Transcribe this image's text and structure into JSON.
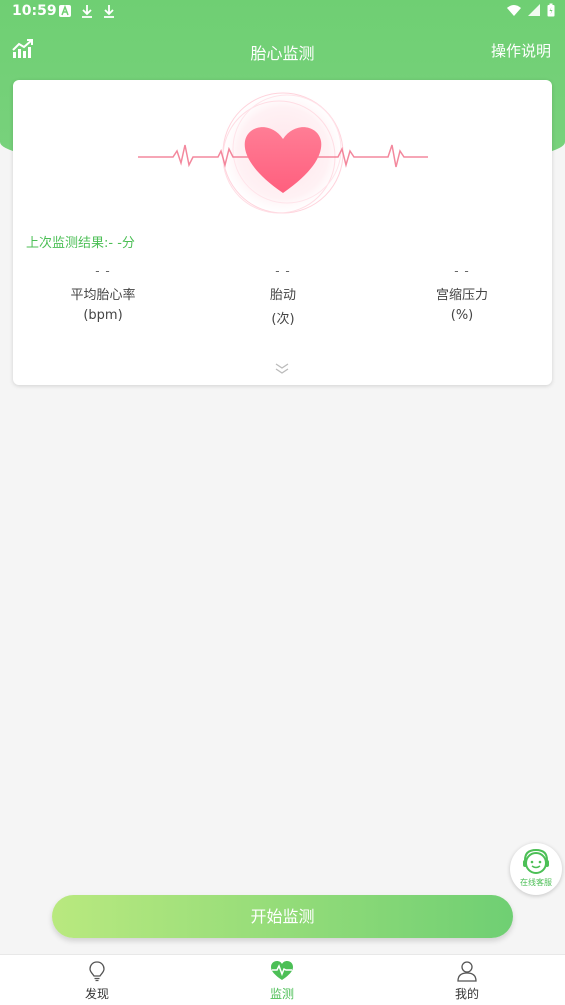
{
  "status_bar": {
    "time": "10:59",
    "icons": [
      "a-box-icon",
      "download-icon",
      "download-icon",
      "wifi-icon",
      "cell-signal-icon",
      "battery-icon"
    ]
  },
  "header": {
    "title": "胎心监测",
    "help_label": "操作说明",
    "trend_icon": "trend-chart-icon"
  },
  "card": {
    "last_result": "上次监测结果:- -分",
    "stats": [
      {
        "value": "- -",
        "label": "平均胎心率",
        "unit": "(bpm)"
      },
      {
        "value": "- -",
        "label": "胎动",
        "unit": "(次)"
      },
      {
        "value": "- -",
        "label": "宫缩压力",
        "unit": "(%)"
      }
    ]
  },
  "service": {
    "label": "在线客服"
  },
  "start_button": {
    "label": "开始监测"
  },
  "bottom_nav": [
    {
      "label": "发现",
      "icon": "lightbulb-icon",
      "active": false
    },
    {
      "label": "监测",
      "icon": "heart-pulse-icon",
      "active": true
    },
    {
      "label": "我的",
      "icon": "person-icon",
      "active": false
    }
  ],
  "colors": {
    "brand_green": "#6fcf73",
    "accent_text": "#4cbf56",
    "heart_pink": "#ff6f8b"
  }
}
